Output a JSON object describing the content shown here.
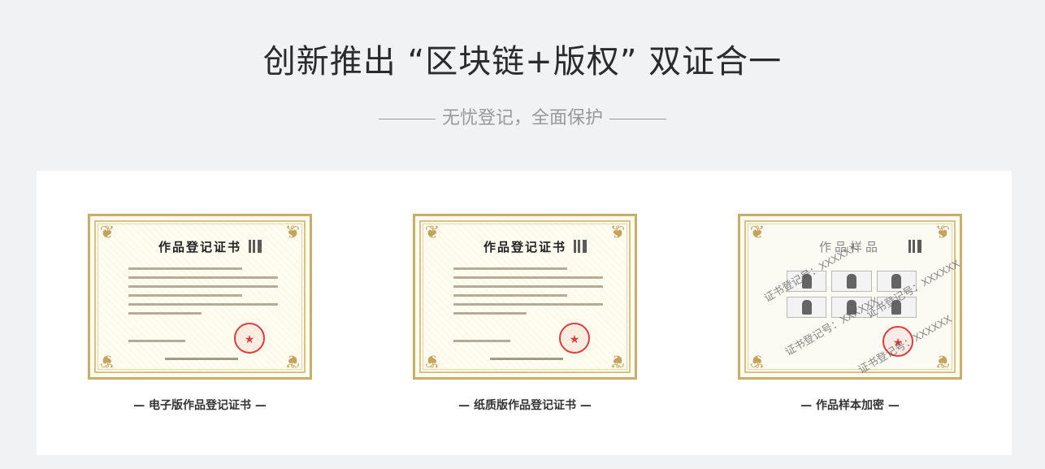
{
  "header": {
    "title": "创新推出 “区块链+版权” 双证合一",
    "subtitle": "无忧登记，全面保护"
  },
  "cards": [
    {
      "cert_title": "作品登记证书",
      "caption": "— 电子版作品登记证书 —"
    },
    {
      "cert_title": "作品登记证书",
      "caption": "— 纸质版作品登记证书 —"
    },
    {
      "cert_title": "作品样品",
      "caption": "— 作品样本加密 —",
      "watermark": "证书登记号：XXXXXX"
    }
  ],
  "colors": {
    "background": "#f1f2f4",
    "panel": "#ffffff",
    "frame_gold": "#c9ad6a",
    "seal_red": "#e13b3b"
  }
}
